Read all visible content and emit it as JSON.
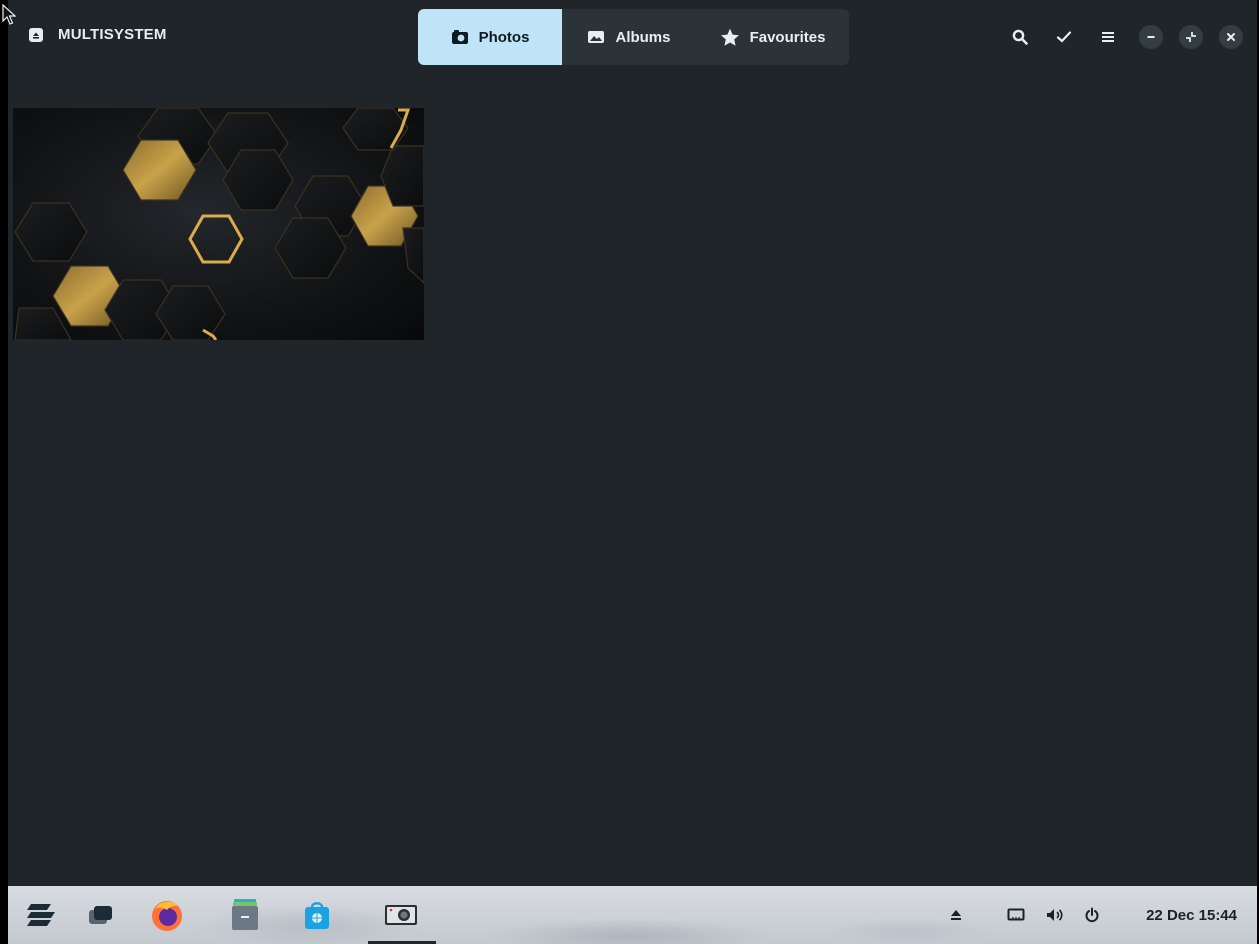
{
  "app": {
    "title": "MULTISYSTEM",
    "icon": "app-icon"
  },
  "tabs": [
    {
      "label": "Photos",
      "icon": "camera-icon",
      "active": true
    },
    {
      "label": "Albums",
      "icon": "image-icon",
      "active": false
    },
    {
      "label": "Favourites",
      "icon": "star-icon",
      "active": false
    }
  ],
  "header_actions": [
    "search-icon",
    "select-check-icon",
    "menu-icon",
    "minimize-icon",
    "restore-icon",
    "close-icon"
  ],
  "gallery": {
    "photos": [
      {
        "subject": "gold-hexagon-wallpaper"
      }
    ]
  },
  "taskbar": {
    "launchers": [
      "zorin-menu-icon",
      "workspace-switcher-icon",
      "firefox-icon",
      "files-icon",
      "software-store-icon",
      "photos-app-icon"
    ],
    "tray": [
      "eject-icon",
      "network-icon",
      "volume-icon",
      "power-icon"
    ],
    "clock": "22 Dec 15:44"
  },
  "colors": {
    "window_bg": "#1f2528",
    "tab_active": "#bfe3f7",
    "tab_bar": "#2b3338",
    "photo_gold": "#c9a24a"
  }
}
